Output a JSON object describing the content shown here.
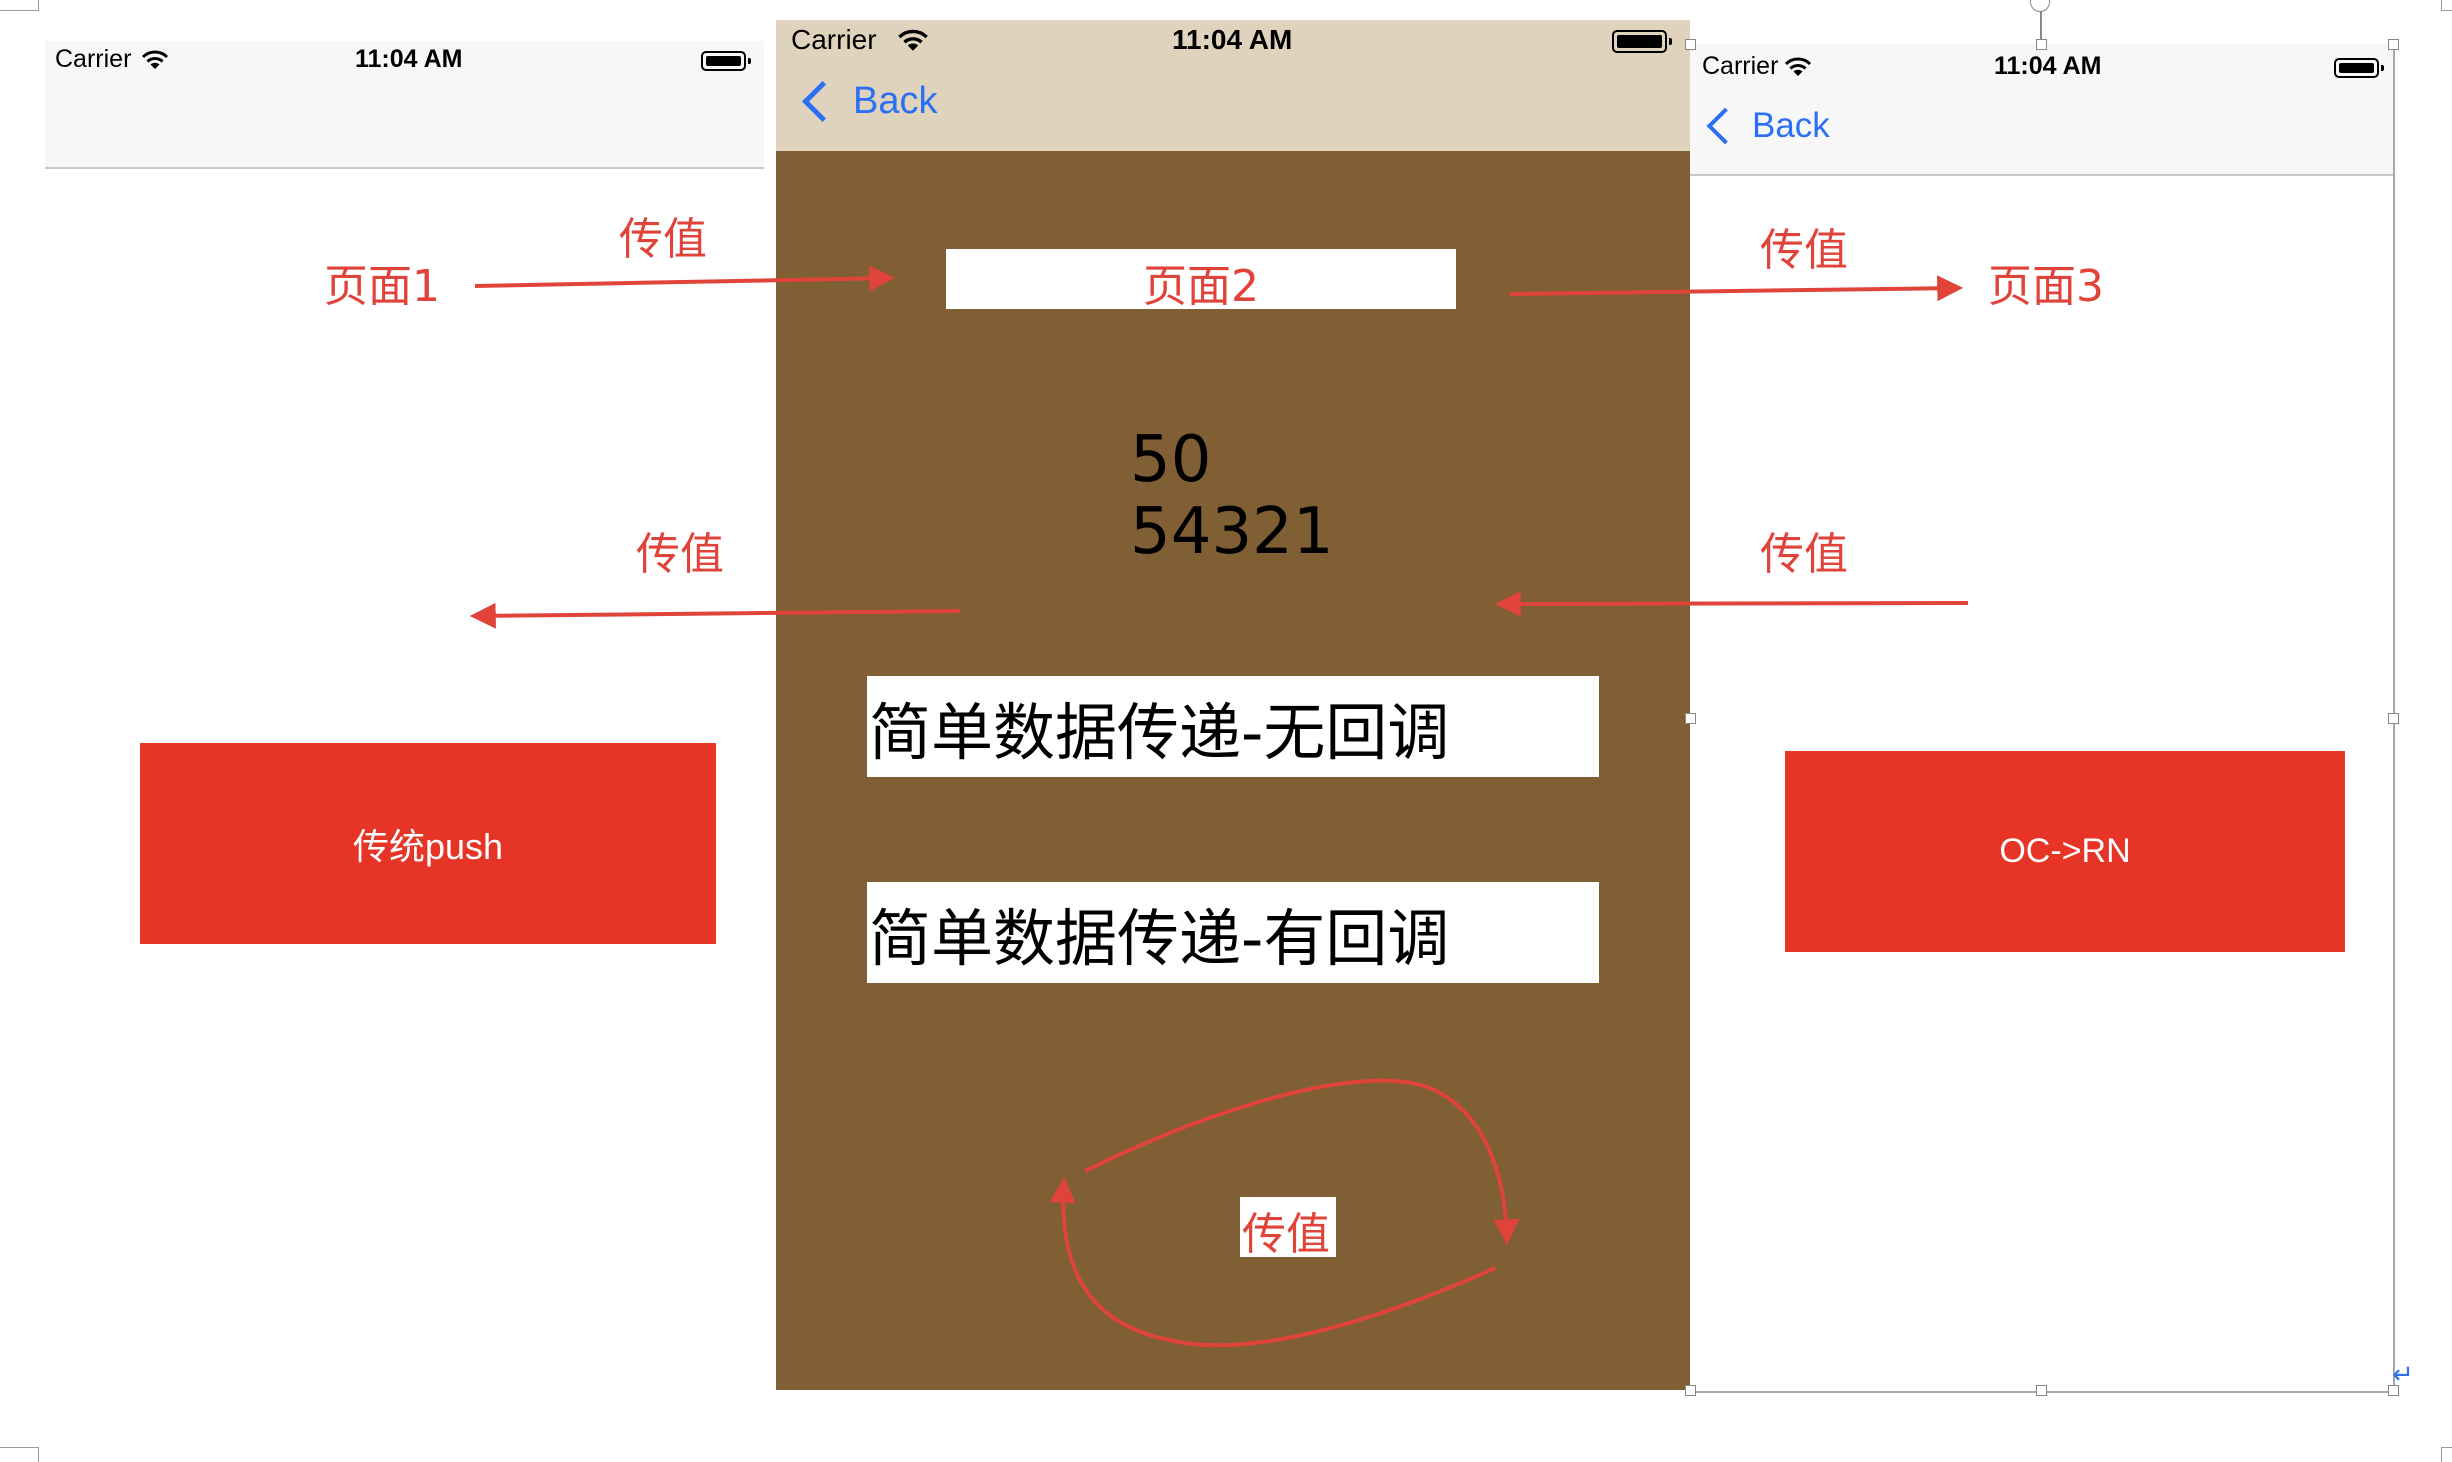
{
  "phone1": {
    "carrier": "Carrier",
    "time": "11:04 AM",
    "push_button_label": "传统push"
  },
  "phone2": {
    "carrier": "Carrier",
    "time": "11:04 AM",
    "back_label": "Back",
    "page_label": "页面2",
    "value_line1": "50",
    "value_line2": "54321",
    "button_no_callback": "简单数据传递-无回调",
    "button_with_callback": "简单数据传递-有回调"
  },
  "phone3": {
    "carrier": "Carrier",
    "time": "11:04 AM",
    "back_label": "Back",
    "oc_rn_button_label": "OC->RN"
  },
  "annotations": {
    "page1": "页面1",
    "page3": "页面3",
    "pass_value_top_left": "传值",
    "pass_value_top_right": "传值",
    "pass_value_mid_left": "传值",
    "pass_value_mid_right": "传值",
    "pass_value_bottom": "传值"
  },
  "colors": {
    "annotation_red": "#e0433a",
    "button_red": "#e63426",
    "phone2_background": "#7f5f33",
    "phone2_navbar": "#e0d3bd",
    "ios_blue": "#2a6ff4"
  },
  "icons": [
    "wifi-icon",
    "battery-icon",
    "back-chevron-icon",
    "arrow-icon"
  ]
}
